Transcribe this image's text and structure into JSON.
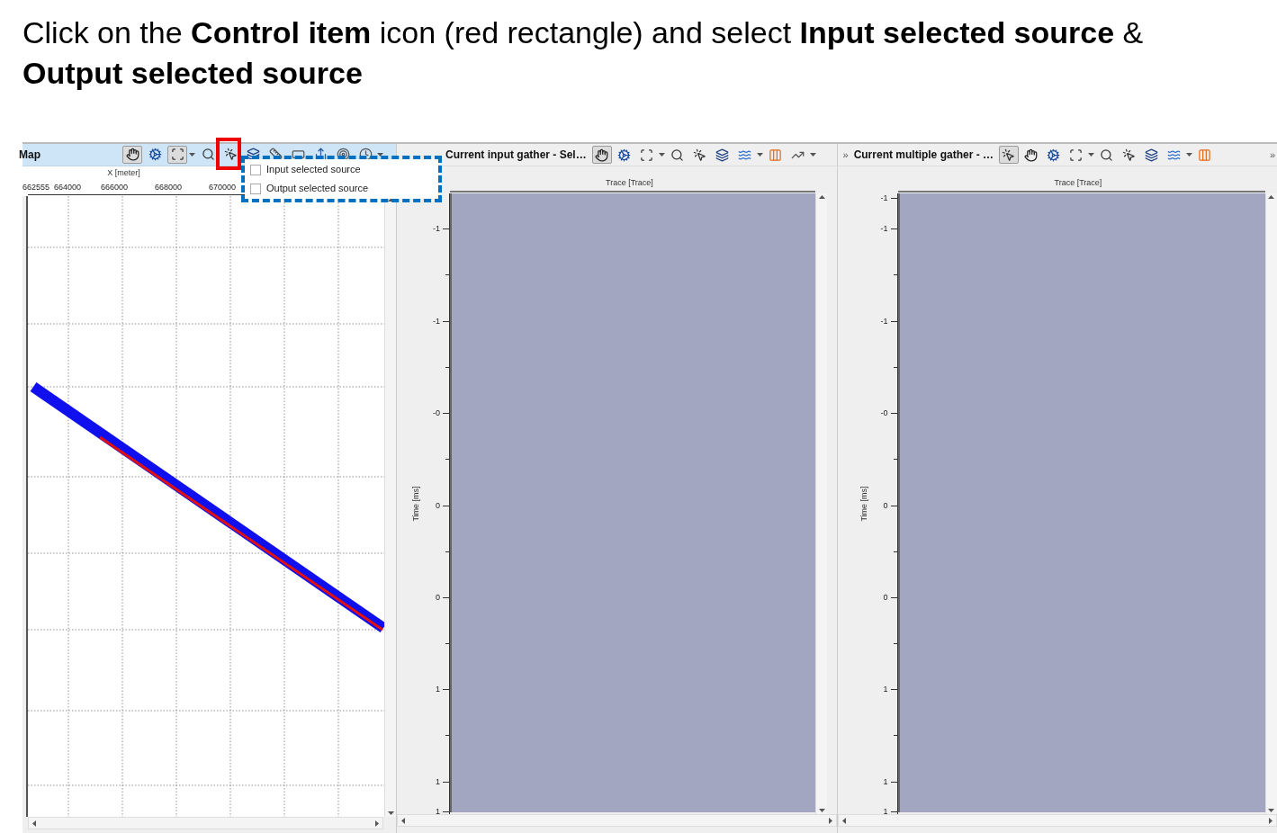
{
  "instruction": "Click on the **Control item** icon (red rectangle) and select **Input selected source** & **Output selected source**",
  "panels": [
    {
      "kind": "map",
      "title": "Map",
      "x_axis_label": "X [meter]",
      "x_ticks": [
        "662555",
        "664000",
        "666000",
        "668000",
        "670000"
      ],
      "tools": [
        {
          "kind": "hand",
          "selected": true,
          "dropdown": false
        },
        {
          "kind": "gear",
          "selected": false,
          "dropdown": false
        },
        {
          "kind": "select",
          "selected": true,
          "dropdown": true
        },
        {
          "kind": "zoom",
          "selected": false,
          "dropdown": false
        },
        {
          "kind": "pointer",
          "selected": false,
          "dropdown": false
        },
        {
          "kind": "layers",
          "selected": false,
          "dropdown": false
        },
        {
          "kind": "measure",
          "selected": false,
          "dropdown": false
        },
        {
          "kind": "rect",
          "selected": false,
          "dropdown": false
        },
        {
          "kind": "export",
          "selected": false,
          "dropdown": false
        },
        {
          "kind": "target",
          "selected": false,
          "dropdown": false
        },
        {
          "kind": "clock",
          "selected": false,
          "dropdown": true
        }
      ]
    },
    {
      "kind": "gather",
      "title": "Current input gather - Sel…",
      "x_axis_label": "Trace [Trace]",
      "y_axis_label": "Time [ms]",
      "y_ticks": [
        "-1",
        "-1",
        "-0",
        "0",
        "0",
        "1",
        "1",
        "1"
      ],
      "tools": [
        {
          "kind": "hand",
          "selected": true,
          "dropdown": false
        },
        {
          "kind": "gear",
          "selected": false,
          "dropdown": false
        },
        {
          "kind": "select",
          "selected": false,
          "dropdown": true
        },
        {
          "kind": "zoom",
          "selected": false,
          "dropdown": false
        },
        {
          "kind": "pointer",
          "selected": false,
          "dropdown": false
        },
        {
          "kind": "layers",
          "selected": false,
          "dropdown": false
        },
        {
          "kind": "wiggle",
          "selected": false,
          "dropdown": true
        },
        {
          "kind": "traces",
          "selected": false,
          "dropdown": false
        },
        {
          "kind": "chart",
          "selected": false,
          "dropdown": true
        }
      ]
    },
    {
      "kind": "gather",
      "lead_marker": "»",
      "title": "Current multiple gather - …",
      "overflow_marker": "»",
      "x_axis_label": "Trace [Trace]",
      "y_axis_label": "Time [ms]",
      "y_ticks": [
        "-1",
        "-1",
        "-1",
        "-0",
        "0",
        "0",
        "1",
        "1",
        "1"
      ],
      "tools": [
        {
          "kind": "pointer",
          "selected": true,
          "dropdown": false
        },
        {
          "kind": "hand",
          "selected": false,
          "dropdown": false
        },
        {
          "kind": "gear",
          "selected": false,
          "dropdown": false
        },
        {
          "kind": "select",
          "selected": false,
          "dropdown": true
        },
        {
          "kind": "zoom",
          "selected": false,
          "dropdown": false
        },
        {
          "kind": "pointer",
          "selected": false,
          "dropdown": false
        },
        {
          "kind": "layers",
          "selected": false,
          "dropdown": false
        },
        {
          "kind": "wiggle",
          "selected": false,
          "dropdown": true
        },
        {
          "kind": "traces",
          "selected": false,
          "dropdown": false
        }
      ]
    }
  ],
  "dropdown_menu": {
    "items": [
      {
        "label": "Input selected source",
        "checked": false
      },
      {
        "label": "Output selected source",
        "checked": false
      }
    ]
  }
}
